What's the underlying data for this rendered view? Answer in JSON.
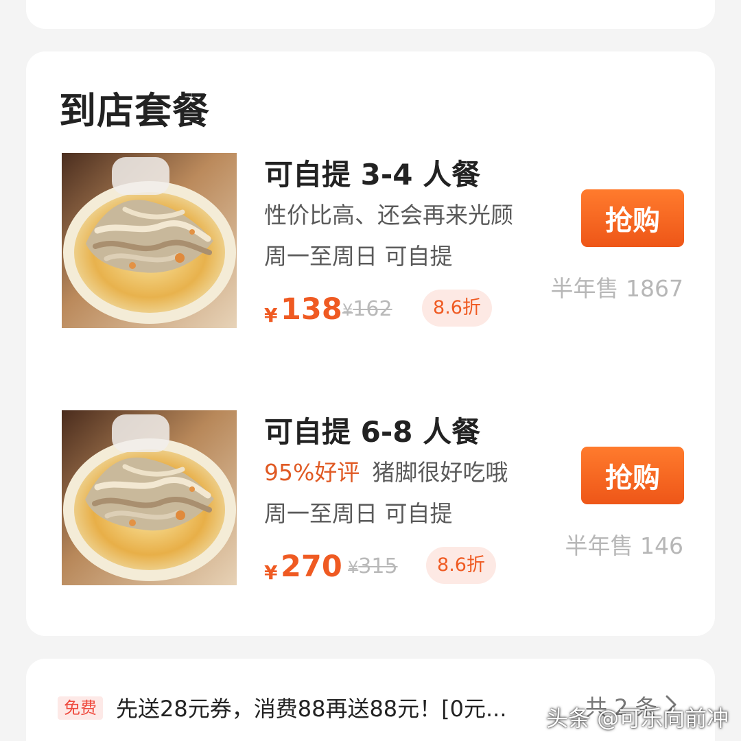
{
  "section": {
    "title": "到店套餐"
  },
  "deals": [
    {
      "title": "可自提 3-4 人餐",
      "line1": "性价比高、还会再来光顾",
      "line2": "周一至周日  可自提",
      "currency": "¥",
      "price": "138",
      "old_price_currency": "¥",
      "old_price": "162",
      "discount": "8.6折",
      "buy_label": "抢购",
      "sales": "半年售 1867",
      "image_icon": "food-photo-icon"
    },
    {
      "title": "可自提 6-8 人餐",
      "rating": "95%好评",
      "line1": "猪脚很好吃哦",
      "line2": "周一至周日  可自提",
      "currency": "¥",
      "price": "270",
      "old_price_currency": "¥",
      "old_price": "315",
      "discount": "8.6折",
      "buy_label": "抢购",
      "sales": "半年售 146",
      "image_icon": "food-photo-icon"
    }
  ],
  "promotion": {
    "badge": "免费",
    "text": "先送28元券，消费88再送88元！[0元...",
    "more": "共 2 条",
    "chevron_icon": "chevron-right-icon"
  },
  "watermark": {
    "text": "头条 @可乐向前冲"
  },
  "colors": {
    "accent": "#ef5a22",
    "button": "#ee5618",
    "muted": "#b7b7b7",
    "badge_red": "#ef4b3f"
  }
}
